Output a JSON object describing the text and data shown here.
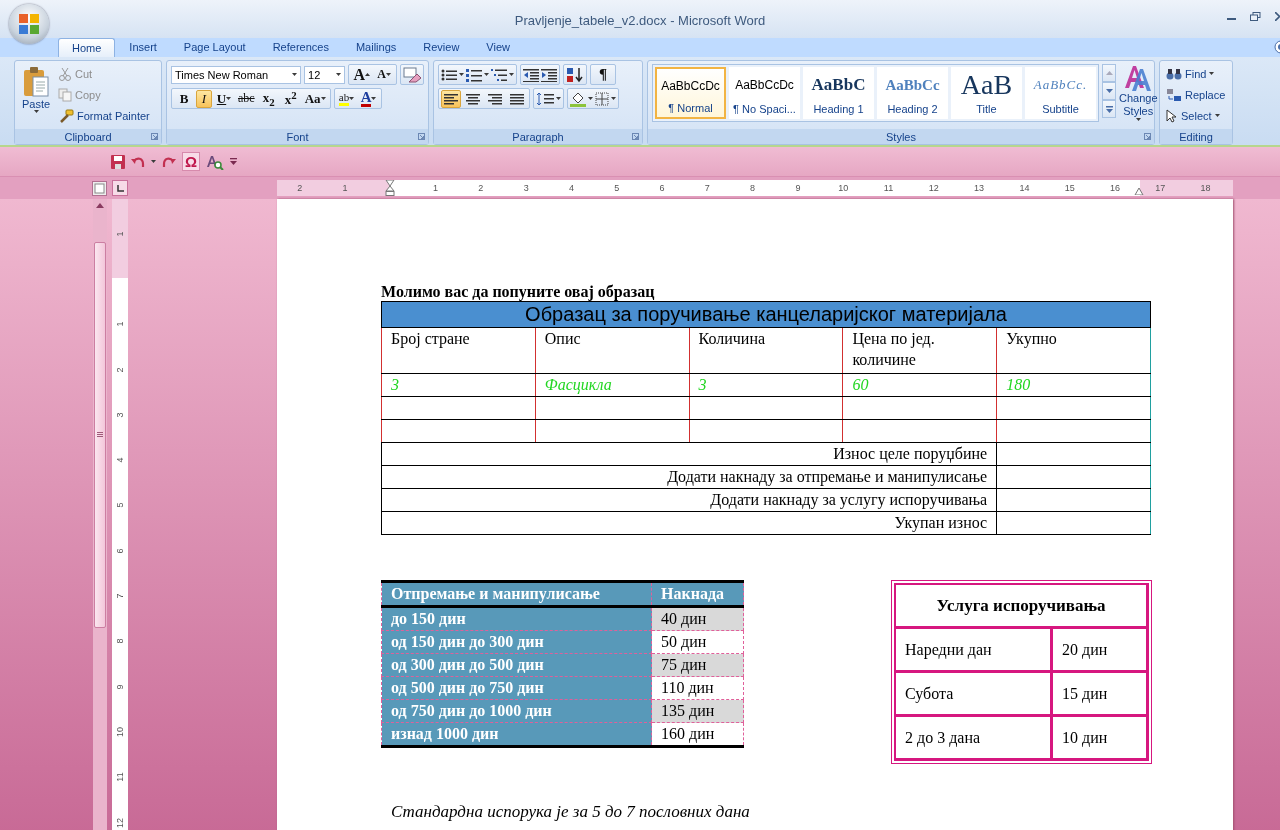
{
  "window": {
    "title": "Pravljenje_tabele_v2.docx - Microsoft Word"
  },
  "tabs": [
    {
      "label": "Home",
      "selected": true
    },
    {
      "label": "Insert",
      "selected": false
    },
    {
      "label": "Page Layout",
      "selected": false
    },
    {
      "label": "References",
      "selected": false
    },
    {
      "label": "Mailings",
      "selected": false
    },
    {
      "label": "Review",
      "selected": false
    },
    {
      "label": "View",
      "selected": false
    }
  ],
  "ribbon": {
    "clipboard": {
      "label": "Clipboard",
      "paste": "Paste",
      "actions": [
        {
          "kind": "cut",
          "label": "Cut",
          "disabled": true
        },
        {
          "kind": "copy",
          "label": "Copy",
          "disabled": true
        },
        {
          "kind": "painter",
          "label": "Format Painter",
          "disabled": false
        }
      ]
    },
    "font": {
      "label": "Font",
      "font_name": "Times New Roman",
      "font_size": "12",
      "grow": "A",
      "shrink": "A",
      "format_buttons": [
        {
          "kind": "bold",
          "text": "B",
          "selected": false
        },
        {
          "kind": "italic",
          "text": "I",
          "selected": true
        },
        {
          "kind": "underline",
          "text": "U",
          "selected": false
        },
        {
          "kind": "strike",
          "text": "abc",
          "selected": false
        },
        {
          "kind": "sub",
          "text": "x$_{2}$",
          "selected": false
        },
        {
          "kind": "sup",
          "text": "x$^{2}$",
          "selected": false
        },
        {
          "kind": "case",
          "text": "Aa",
          "selected": false
        }
      ],
      "highlight": "ab",
      "font_color": "A"
    },
    "paragraph": {
      "label": "Paragraph",
      "pilcrow": "¶",
      "alignments": [
        {
          "kind": "left",
          "selected": true
        },
        {
          "kind": "center",
          "selected": false
        },
        {
          "kind": "right",
          "selected": false
        },
        {
          "kind": "justify",
          "selected": false
        }
      ]
    },
    "styles": {
      "label": "Styles",
      "items": [
        {
          "kind": "normal",
          "preview": "AaBbCcDc",
          "label": "¶ Normal",
          "selected": true
        },
        {
          "kind": "normal",
          "preview": "AaBbCcDc",
          "label": "¶ No Spaci...",
          "selected": false
        },
        {
          "kind": "heading1",
          "preview": "AaBbC",
          "label": "Heading 1",
          "selected": false
        },
        {
          "kind": "heading2",
          "preview": "AaBbCc",
          "label": "Heading 2",
          "selected": false
        },
        {
          "kind": "title",
          "preview": "AaB",
          "label": "Title",
          "selected": false
        },
        {
          "kind": "subtitle",
          "preview": "AaBbCc.",
          "label": "Subtitle",
          "selected": false
        }
      ],
      "change_styles": "Change Styles"
    },
    "editing": {
      "label": "Editing",
      "items": [
        {
          "kind": "find",
          "label": "Find"
        },
        {
          "kind": "replace",
          "label": "Replace"
        },
        {
          "kind": "select",
          "label": "Select"
        }
      ]
    }
  },
  "quick_access": {
    "symbol": "Ω"
  },
  "ruler": {
    "left_labels": [
      "2",
      "1"
    ],
    "right_labels": [
      "1",
      "2",
      "3",
      "4",
      "5",
      "6",
      "7",
      "8",
      "9",
      "10",
      "11",
      "12",
      "13",
      "14",
      "15",
      "16",
      "17",
      "18"
    ]
  },
  "vertical_ruler": {
    "top_labels": [
      "1"
    ],
    "labels": [
      "1",
      "2",
      "3",
      "4",
      "5",
      "6",
      "7",
      "8",
      "9",
      "10",
      "11",
      "12"
    ]
  },
  "document": {
    "intro": "Молимо вас да попуните овај образац",
    "order_table": {
      "title": "Образац за поручивање канцеларијског материјала",
      "columns": [
        "Број стране",
        "Опис",
        "Количина",
        "Цена по јед. количине",
        "Укупно"
      ],
      "rows": [
        {
          "kind": "entry",
          "cells": [
            "3",
            "Фасцикла",
            "3",
            "60",
            "180"
          ]
        },
        {
          "kind": "blank"
        },
        {
          "kind": "blank"
        }
      ],
      "summary": [
        "Износ целе поруџбине",
        "Додати накнаду за отпремање и манипулисање",
        "Додати накнаду за услугу испоручивања",
        "Укупан износ"
      ]
    },
    "shipping_table": {
      "columns": [
        "Отпремање и манипулисање",
        "Накнада"
      ],
      "rows": [
        [
          "до 150 дин",
          "40 дин"
        ],
        [
          "од 150 дин до 300 дин",
          "50 дин"
        ],
        [
          "од 300 дин до 500 дин",
          "75 дин"
        ],
        [
          "од 500 дин до 750 дин",
          "110 дин"
        ],
        [
          "од 750 дин до 1000 дин",
          "135 дин"
        ],
        [
          "изнад 1000 дин",
          "160 дин"
        ]
      ]
    },
    "delivery_table": {
      "title": "Услуга испоручивања",
      "rows": [
        [
          "Наредни дан",
          "20 дин"
        ],
        [
          "Субота",
          "15 дин"
        ],
        [
          "2 до 3 дана",
          "10 дин"
        ]
      ]
    },
    "note": "Стандардна испорука је за 5 до 7 пословних дана"
  }
}
